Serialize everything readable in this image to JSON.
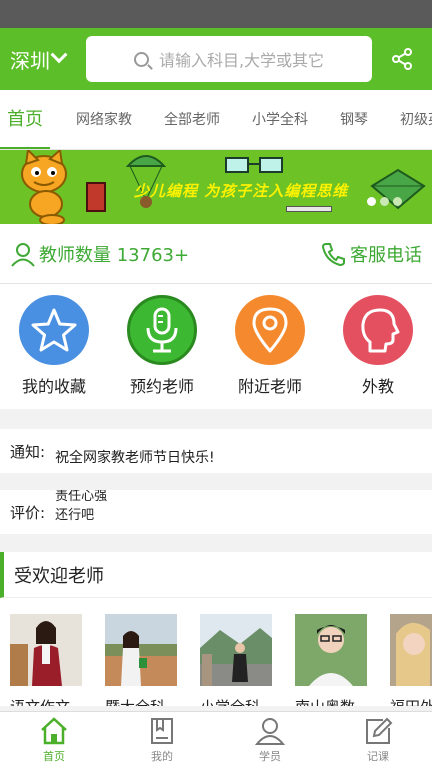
{
  "header": {
    "city": "深圳",
    "search_placeholder": "请输入科目,大学或其它"
  },
  "tabs": [
    {
      "label": "首页"
    },
    {
      "label": "网络家教"
    },
    {
      "label": "全部老师"
    },
    {
      "label": "小学全科"
    },
    {
      "label": "钢琴"
    },
    {
      "label": "初级英"
    }
  ],
  "banner": {
    "text": "少儿编程  为孩子注入编程思维"
  },
  "stats": {
    "teacher_count": "教师数量 13763+",
    "hotline": "客服电话"
  },
  "shortcuts": [
    {
      "label": "我的收藏",
      "color": "#4a90e2",
      "icon": "star-icon"
    },
    {
      "label": "预约老师",
      "color": "#3db832",
      "icon": "microphone-icon"
    },
    {
      "label": "附近老师",
      "color": "#f5892e",
      "icon": "location-pin-icon"
    },
    {
      "label": "外教",
      "color": "#e4505f",
      "icon": "head-icon"
    }
  ],
  "notice": {
    "label": "通知:",
    "text": "祝全网家教老师节日快乐!"
  },
  "review": {
    "label": "评价:",
    "line1": "责任心强",
    "line2": "还行吧"
  },
  "popular": {
    "title": "受欢迎老师",
    "teachers": [
      {
        "name": "语文作文..."
      },
      {
        "name": "暨大全科"
      },
      {
        "name": "小学全科..."
      },
      {
        "name": "南山奥数..."
      },
      {
        "name": "福田外"
      }
    ]
  },
  "bottom_nav": [
    {
      "label": "首页",
      "icon": "home-icon"
    },
    {
      "label": "我的",
      "icon": "book-icon"
    },
    {
      "label": "学员",
      "icon": "person-icon"
    },
    {
      "label": "记课",
      "icon": "edit-icon"
    }
  ]
}
